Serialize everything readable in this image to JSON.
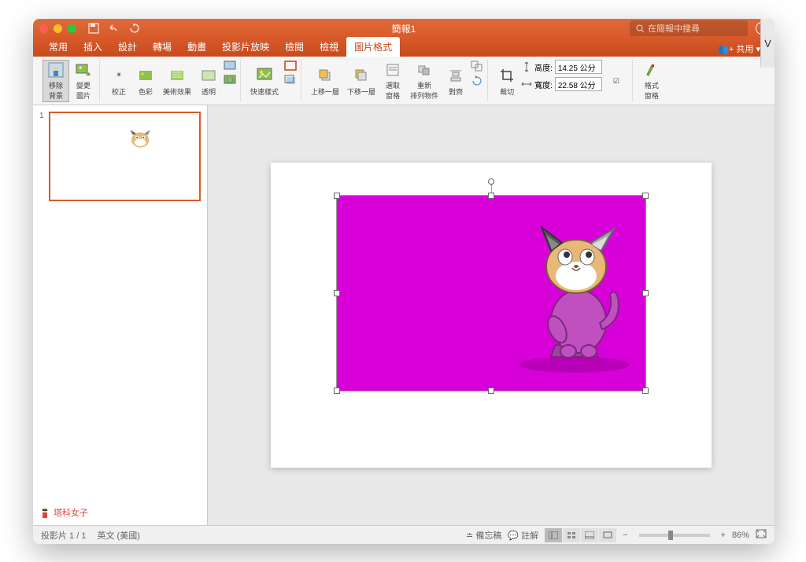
{
  "window": {
    "title": "簡報1",
    "search_placeholder": "在簡報中搜尋"
  },
  "tabs": {
    "items": [
      "常用",
      "插入",
      "設計",
      "轉場",
      "動畫",
      "投影片放映",
      "檢閱",
      "檢視",
      "圖片格式"
    ],
    "active_index": 8,
    "share": "共用"
  },
  "ribbon": {
    "remove_bg": "移除\n背景",
    "change_pic": "變更\n圖片",
    "corrections": "校正",
    "color": "色彩",
    "artistic": "美術效果",
    "transparency": "透明",
    "quick_styles": "快速樣式",
    "bring_forward": "上移一層",
    "send_backward": "下移一層",
    "selection_pane": "選取\n窗格",
    "reorder": "重新\n排列物件",
    "align": "對齊",
    "crop": "裁切",
    "height_label": "高度:",
    "height_value": "14.25 公分",
    "width_label": "寬度:",
    "width_value": "22.58 公分",
    "format_pane": "格式\n窗格"
  },
  "thumbnail": {
    "number": "1"
  },
  "watermark": "塔科女子",
  "statusbar": {
    "slide_count": "投影片 1 / 1",
    "language": "英文 (美國)",
    "notes": "備忘稿",
    "comments": "註解",
    "zoom": "86%"
  }
}
